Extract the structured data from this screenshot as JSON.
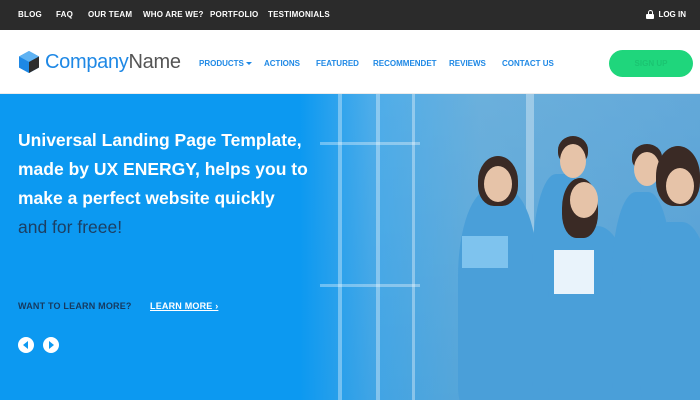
{
  "topbar": {
    "links": [
      "BLOG",
      "FAQ",
      "OUR TEAM",
      "WHO ARE WE?",
      "PORTFOLIO",
      "TESTIMONIALS"
    ],
    "login_label": "LOG IN"
  },
  "header": {
    "logo": {
      "company": "Company",
      "name": "Name"
    },
    "nav": [
      "PRODUCTS",
      "ACTIONS",
      "FEATURED",
      "RECOMMENDET",
      "REVIEWS",
      "CONTACT US"
    ],
    "signup_label": "SIGN UP"
  },
  "hero": {
    "headline_main": "Universal Landing Page Template, made by UX ENERGY, helps you to make a perfect website quickly",
    "headline_muted": " and for freee!",
    "learn_question": "WANT TO LEARN MORE?",
    "learn_more": "LEARN MORE ›"
  },
  "colors": {
    "topbar_bg": "#2b2b2b",
    "brand_blue": "#1e88e5",
    "hero_blue": "#0c99f1",
    "signup_green": "#1fd67c"
  },
  "icons": [
    "lock-icon",
    "company-logo-icon",
    "chevron-down-icon",
    "arrow-left-icon",
    "arrow-right-icon"
  ]
}
